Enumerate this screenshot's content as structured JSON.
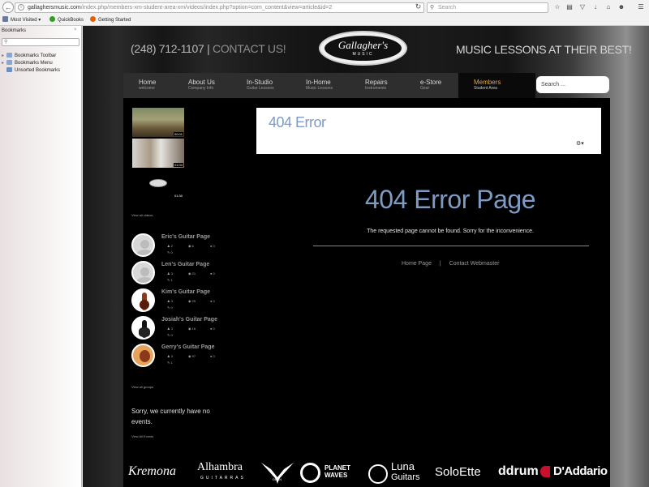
{
  "browser": {
    "url_host": "gallaghersmusic.com",
    "url_path": "/index.php/members-xm-student-area-xm/videos/index.php?option=com_content&view=article&id=2",
    "search_placeholder": "Search",
    "bookmarks_bar": [
      {
        "label": "Most Visited ▾",
        "icon_color": "#6b7b9c"
      },
      {
        "label": "QuickBooks",
        "icon_color": "#2ca01c"
      },
      {
        "label": "Getting Started",
        "icon_color": "#e66000"
      }
    ]
  },
  "sidebar": {
    "title": "Bookmarks",
    "close": "×",
    "items": [
      "Bookmarks Toolbar",
      "Bookmarks Menu",
      "Unsorted Bookmarks"
    ]
  },
  "header": {
    "phone": "(248) 712-1107",
    "separator": "|",
    "contact": "CONTACT US!",
    "logo_word": "Gallagher's",
    "logo_sub": "MUSIC",
    "tagline": "MUSIC LESSONS AT THEIR BEST!"
  },
  "menu": [
    {
      "title": "Home",
      "sub": "welcome"
    },
    {
      "title": "About Us",
      "sub": "Company Info"
    },
    {
      "title": "In-Studio",
      "sub": "Guitar Lessons"
    },
    {
      "title": "In-Home",
      "sub": "Music Lessons"
    },
    {
      "title": "Repairs",
      "sub": "Instruments"
    },
    {
      "title": "e-Store",
      "sub": "Gear"
    },
    {
      "title": "Members",
      "sub": "Student Area"
    }
  ],
  "menu_active_color": "#e3a64a",
  "site_search_placeholder": "Search ...",
  "videos": [
    {
      "duration": "00:01"
    },
    {
      "duration": "01:04"
    },
    {
      "duration": "01:30"
    }
  ],
  "view_all_videos": "View all videos",
  "groups": [
    {
      "name": "Eric's Guitar Page",
      "members": "2",
      "views": "6",
      "comments": "0",
      "edit": "0"
    },
    {
      "name": "Len's Guitar Page",
      "members": "3",
      "views": "21",
      "comments": "0",
      "edit": "1"
    },
    {
      "name": "Kim's Guitar Page",
      "members": "3",
      "views": "25",
      "comments": "0",
      "edit": "0"
    },
    {
      "name": "Josiah's Guitar Page",
      "members": "3",
      "views": "16",
      "comments": "0",
      "edit": "0"
    },
    {
      "name": "Gerry's Guitar Page",
      "members": "3",
      "views": "97",
      "comments": "0",
      "edit": "1"
    }
  ],
  "view_all_groups": "View all groups",
  "events_text": "Sorry, we currently have no events.",
  "view_all_events": "View All Events",
  "error": {
    "box_title": "404 Error",
    "big_title": "404 Error Page",
    "message": "The requested page cannot be found. Sorry for the inconvenience.",
    "link_home": "Home Page",
    "link_sep": "|",
    "link_contact": "Contact Webmaster"
  },
  "accent_color": "#7e9bc4",
  "brands": [
    "Kremona",
    "Alhambra",
    "GUITARRAS",
    "DEAN",
    "PLANET",
    "WAVES",
    "Luna",
    "Guitars",
    "SoloEtte",
    "ddrum",
    "D'Addario"
  ]
}
